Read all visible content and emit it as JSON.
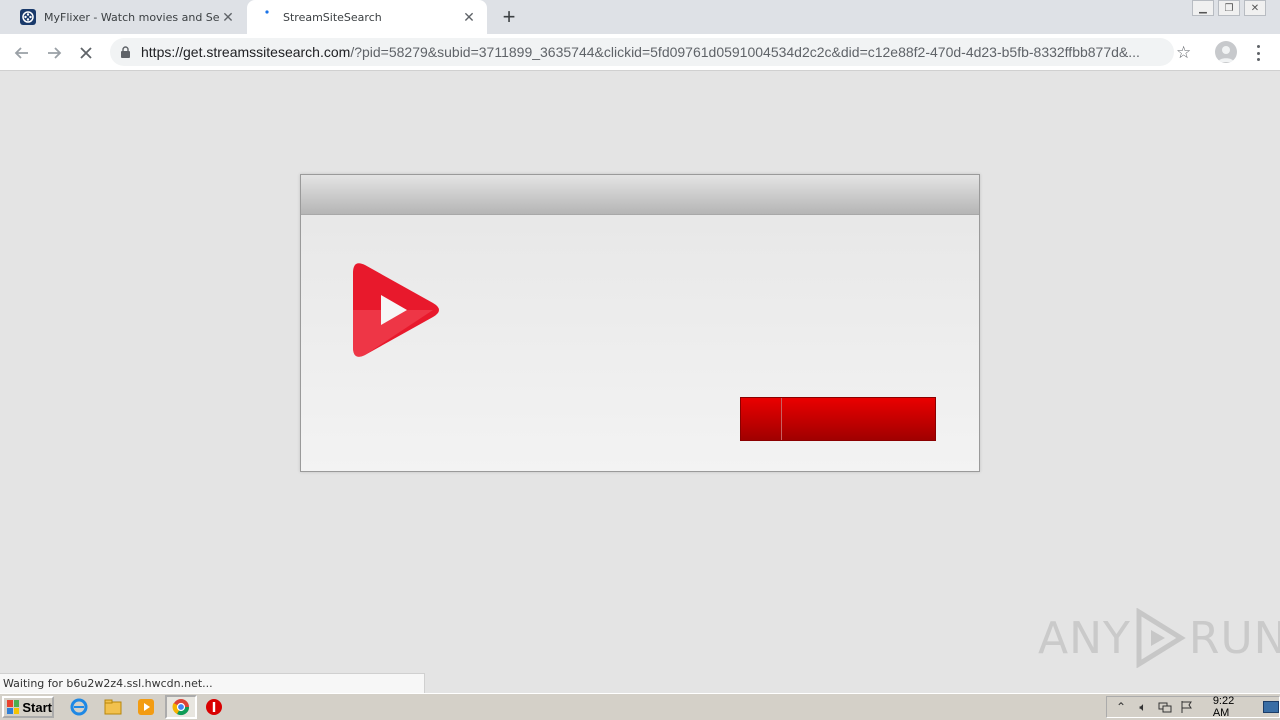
{
  "browser": {
    "tabs": [
      {
        "title": "MyFlixer - Watch movies and Series",
        "active": false
      },
      {
        "title": "StreamSiteSearch",
        "active": true
      }
    ],
    "url_host": "https://get.streamssitesearch.com",
    "url_rest": "/?pid=58279&subid=3711899_3635744&clickid=5fd09761d0591004534d2c2c&did=c12e88f2-470d-4d23-b5fb-8332ffbb877d&...",
    "status_text": "Waiting for b6u2w2z4.ssl.hwcdn.net..."
  },
  "page": {
    "accent_color": "#e8192c",
    "button_color": "#d40000"
  },
  "watermark": {
    "left": "ANY",
    "right": "RUN"
  },
  "taskbar": {
    "start_label": "Start",
    "clock": "9:22 AM"
  }
}
